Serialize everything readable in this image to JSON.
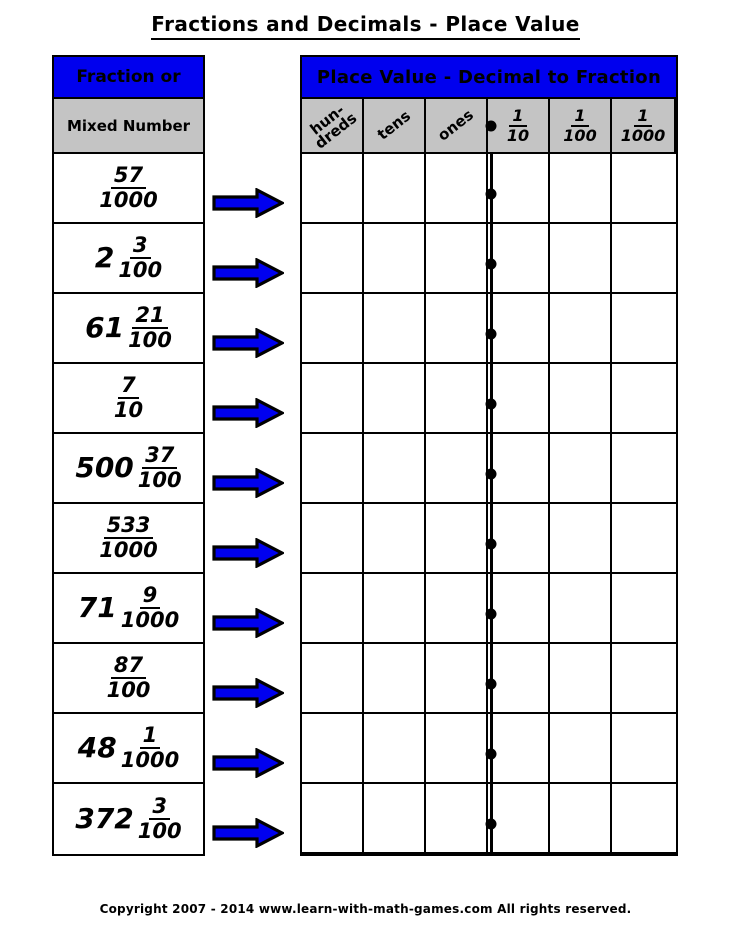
{
  "page": {
    "title": "Fractions and Decimals - Place Value",
    "footer": "Copyright  2007 - 2014  www.learn-with-math-games.com  All rights reserved."
  },
  "colors": {
    "header_blue": "#0000EE",
    "header_gray": "#C4C4C4",
    "arrow_fill": "#0000EE",
    "line_black": "#000000",
    "page_background": "#FFFFFF"
  },
  "left_table": {
    "header_top": "Fraction or",
    "header_bottom": "Mixed Number",
    "rows": [
      {
        "whole": "",
        "numerator": "57",
        "denominator": "1000"
      },
      {
        "whole": "2",
        "numerator": "3",
        "denominator": "100"
      },
      {
        "whole": "61",
        "numerator": "21",
        "denominator": "100"
      },
      {
        "whole": "",
        "numerator": "7",
        "denominator": "10"
      },
      {
        "whole": "500",
        "numerator": "37",
        "denominator": "100"
      },
      {
        "whole": "",
        "numerator": "533",
        "denominator": "1000"
      },
      {
        "whole": "71",
        "numerator": "9",
        "denominator": "1000"
      },
      {
        "whole": "",
        "numerator": "87",
        "denominator": "100"
      },
      {
        "whole": "48",
        "numerator": "1",
        "denominator": "1000"
      },
      {
        "whole": "372",
        "numerator": "3",
        "denominator": "100"
      }
    ]
  },
  "arrows": {
    "icon": "right-arrow-icon",
    "count": 10
  },
  "right_table": {
    "header": "Place Value - Decimal to Fraction",
    "columns": [
      {
        "type": "rotated",
        "label": "hun-\ndreds"
      },
      {
        "type": "rotated",
        "label": "tens"
      },
      {
        "type": "rotated",
        "label": "ones"
      },
      {
        "type": "fraction",
        "numerator": "1",
        "denominator": "10"
      },
      {
        "type": "fraction",
        "numerator": "1",
        "denominator": "100"
      },
      {
        "type": "fraction",
        "numerator": "1",
        "denominator": "1000"
      }
    ],
    "answer_rows": 10,
    "decimal_point_marker": "decimal-point-dot"
  }
}
